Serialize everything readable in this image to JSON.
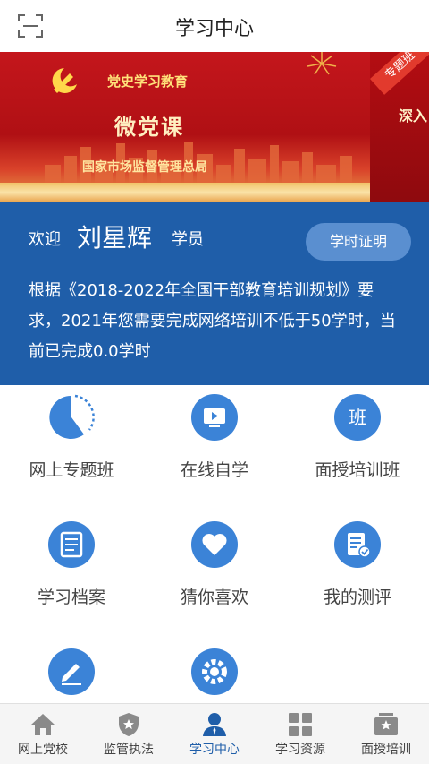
{
  "header": {
    "title": "学习中心",
    "scan_icon": "scan-icon"
  },
  "banner": {
    "subtitle": "党史学习教育",
    "title": "微党课",
    "organization": "国家市场监督管理总局",
    "tag": "专题班",
    "next_slide_text": "深入"
  },
  "welcome": {
    "greeting": "欢迎",
    "user_name": "刘星辉",
    "role": "学员",
    "cert_button": "学时证明",
    "notice": "根据《2018-2022年全国干部教育培训规划》要求，2021年您需要完成网络培训不低于50学时，当前已完成0.0学时"
  },
  "grid": [
    {
      "label": "网上专题班",
      "icon": "pie-chart-icon"
    },
    {
      "label": "在线自学",
      "icon": "video-icon"
    },
    {
      "label": "面授培训班",
      "icon": "class-icon",
      "glyph": "班"
    },
    {
      "label": "学习档案",
      "icon": "document-icon"
    },
    {
      "label": "猜你喜欢",
      "icon": "heart-icon"
    },
    {
      "label": "我的测评",
      "icon": "evaluation-icon"
    },
    {
      "label": "",
      "icon": "edit-icon"
    },
    {
      "label": "",
      "icon": "settings-icon"
    }
  ],
  "bottom_nav": [
    {
      "label": "网上党校",
      "icon": "home-icon",
      "active": false
    },
    {
      "label": "监管执法",
      "icon": "shield-star-icon",
      "active": false
    },
    {
      "label": "学习中心",
      "icon": "user-icon",
      "active": true
    },
    {
      "label": "学习资源",
      "icon": "grid-icon",
      "active": false
    },
    {
      "label": "面授培训",
      "icon": "training-board-icon",
      "active": false
    }
  ],
  "colors": {
    "primary": "#1f5ea9",
    "icon_blue": "#3b83d7",
    "banner_red": "#c4161c"
  }
}
